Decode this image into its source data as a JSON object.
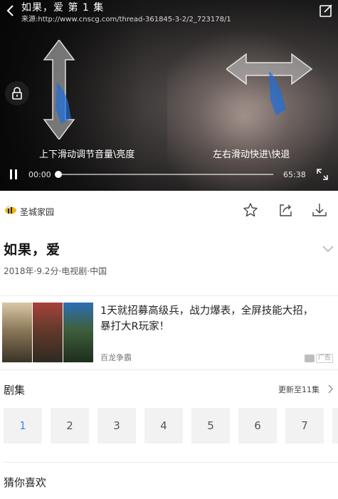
{
  "player": {
    "title": "如果，爱 第 1 集",
    "source": "来源:http://www.cnscg.com/thread-361845-3-2/2_723178/1",
    "hint_vertical": "上下滑动调节音量\\亮度",
    "hint_horizontal": "左右滑动快进\\快退",
    "current_time": "00:00",
    "total_time": "65:38",
    "progress": 0,
    "state": "paused"
  },
  "source_row": {
    "site_name": "圣城家园",
    "actions": [
      "star-icon",
      "share-icon",
      "download-icon"
    ]
  },
  "show": {
    "title": "如果，爱",
    "meta": "2018年·9.2分·电视剧·中国"
  },
  "ad": {
    "headline": "1天就招募高级兵，战力爆表，全屏技能大招，暴打大R玩家！",
    "brand": "百龙争霸",
    "badge": "广告"
  },
  "episodes": {
    "title": "剧集",
    "update_text": "更新至11集",
    "items": [
      "1",
      "2",
      "3",
      "4",
      "5",
      "6",
      "7"
    ],
    "active": "1"
  },
  "recommendations": {
    "title": "猜你喜欢"
  },
  "colors": {
    "accent": "#3a8ef6",
    "episode_bg": "#f2f2f2",
    "divider": "#ececec"
  }
}
